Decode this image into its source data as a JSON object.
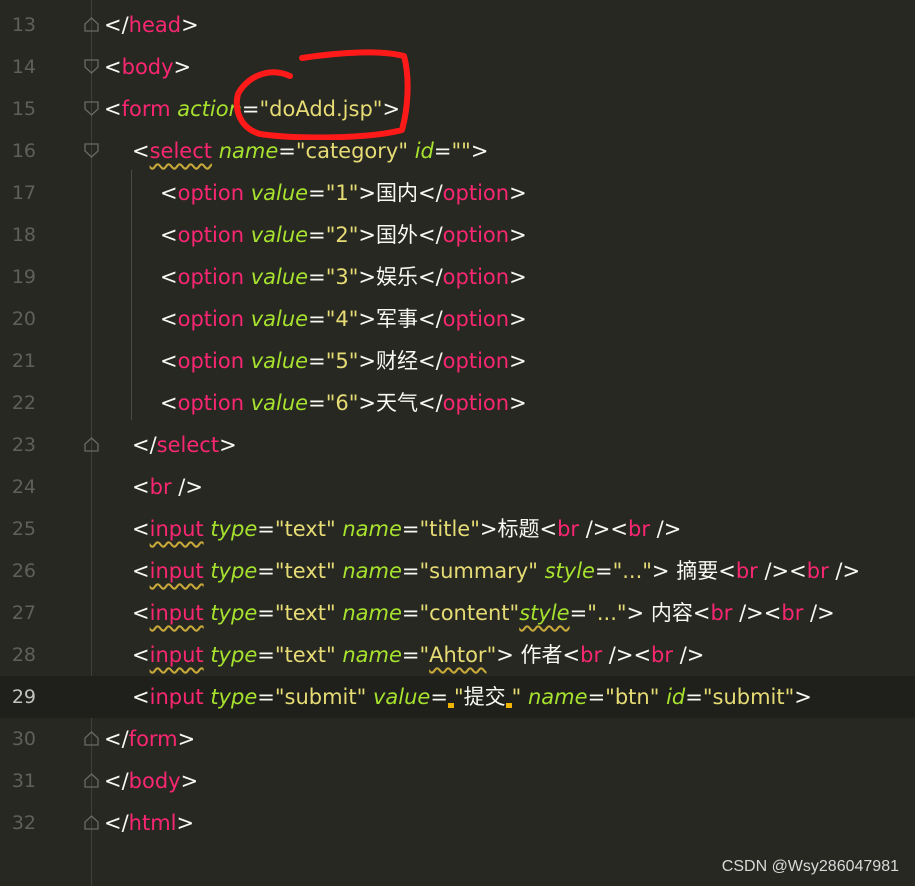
{
  "editor": {
    "lines": [
      {
        "num": "13",
        "parts": [
          [
            "p",
            "</"
          ],
          [
            "t",
            "head"
          ],
          [
            "p",
            ">"
          ]
        ]
      },
      {
        "num": "14",
        "parts": [
          [
            "p",
            "<"
          ],
          [
            "t",
            "body"
          ],
          [
            "p",
            ">"
          ]
        ]
      },
      {
        "num": "15",
        "parts": [
          [
            "p",
            "<"
          ],
          [
            "t",
            "form"
          ],
          [
            "p",
            " "
          ],
          [
            "a",
            "action"
          ],
          [
            "p",
            "="
          ],
          [
            "s",
            "\"doAdd.jsp\""
          ],
          [
            "p",
            ">"
          ]
        ]
      },
      {
        "num": "16",
        "parts": [
          [
            "p",
            "<"
          ],
          [
            "t sq",
            "select"
          ],
          [
            "p",
            " "
          ],
          [
            "a",
            "name"
          ],
          [
            "p",
            "="
          ],
          [
            "s",
            "\"category\""
          ],
          [
            "p",
            " "
          ],
          [
            "a",
            "id"
          ],
          [
            "p",
            "="
          ],
          [
            "s",
            "\"\""
          ],
          [
            "p",
            ">"
          ]
        ]
      },
      {
        "num": "17",
        "parts": [
          [
            "p",
            "<"
          ],
          [
            "t",
            "option"
          ],
          [
            "p",
            " "
          ],
          [
            "a",
            "value"
          ],
          [
            "p",
            "="
          ],
          [
            "s",
            "\"1\""
          ],
          [
            "p",
            ">"
          ],
          [
            "x",
            "国内"
          ],
          [
            "p",
            "</"
          ],
          [
            "t",
            "option"
          ],
          [
            "p",
            ">"
          ]
        ]
      },
      {
        "num": "18",
        "parts": [
          [
            "p",
            "<"
          ],
          [
            "t",
            "option"
          ],
          [
            "p",
            " "
          ],
          [
            "a",
            "value"
          ],
          [
            "p",
            "="
          ],
          [
            "s",
            "\"2\""
          ],
          [
            "p",
            ">"
          ],
          [
            "x",
            "国外"
          ],
          [
            "p",
            "</"
          ],
          [
            "t",
            "option"
          ],
          [
            "p",
            ">"
          ]
        ]
      },
      {
        "num": "19",
        "parts": [
          [
            "p",
            "<"
          ],
          [
            "t",
            "option"
          ],
          [
            "p",
            " "
          ],
          [
            "a",
            "value"
          ],
          [
            "p",
            "="
          ],
          [
            "s",
            "\"3\""
          ],
          [
            "p",
            ">"
          ],
          [
            "x",
            "娱乐"
          ],
          [
            "p",
            "</"
          ],
          [
            "t",
            "option"
          ],
          [
            "p",
            ">"
          ]
        ]
      },
      {
        "num": "20",
        "parts": [
          [
            "p",
            "<"
          ],
          [
            "t",
            "option"
          ],
          [
            "p",
            " "
          ],
          [
            "a",
            "value"
          ],
          [
            "p",
            "="
          ],
          [
            "s",
            "\"4\""
          ],
          [
            "p",
            ">"
          ],
          [
            "x",
            "军事"
          ],
          [
            "p",
            "</"
          ],
          [
            "t",
            "option"
          ],
          [
            "p",
            ">"
          ]
        ]
      },
      {
        "num": "21",
        "parts": [
          [
            "p",
            "<"
          ],
          [
            "t",
            "option"
          ],
          [
            "p",
            " "
          ],
          [
            "a",
            "value"
          ],
          [
            "p",
            "="
          ],
          [
            "s",
            "\"5\""
          ],
          [
            "p",
            ">"
          ],
          [
            "x",
            "财经"
          ],
          [
            "p",
            "</"
          ],
          [
            "t",
            "option"
          ],
          [
            "p",
            ">"
          ]
        ]
      },
      {
        "num": "22",
        "parts": [
          [
            "p",
            "<"
          ],
          [
            "t",
            "option"
          ],
          [
            "p",
            " "
          ],
          [
            "a",
            "value"
          ],
          [
            "p",
            "="
          ],
          [
            "s",
            "\"6\""
          ],
          [
            "p",
            ">"
          ],
          [
            "x",
            "天气"
          ],
          [
            "p",
            "</"
          ],
          [
            "t",
            "option"
          ],
          [
            "p",
            ">"
          ]
        ]
      },
      {
        "num": "23",
        "parts": [
          [
            "p",
            "</"
          ],
          [
            "t",
            "select"
          ],
          [
            "p",
            ">"
          ]
        ]
      },
      {
        "num": "24",
        "parts": [
          [
            "p",
            "<"
          ],
          [
            "t",
            "br"
          ],
          [
            "p",
            " />"
          ]
        ]
      },
      {
        "num": "25",
        "parts": [
          [
            "p",
            "<"
          ],
          [
            "t sq",
            "input"
          ],
          [
            "p",
            " "
          ],
          [
            "a",
            "type"
          ],
          [
            "p",
            "="
          ],
          [
            "s",
            "\"text\""
          ],
          [
            "p",
            " "
          ],
          [
            "a",
            "name"
          ],
          [
            "p",
            "="
          ],
          [
            "s",
            "\"title\""
          ],
          [
            "p",
            ">"
          ],
          [
            "x",
            "标题"
          ],
          [
            "p",
            "<"
          ],
          [
            "t",
            "br"
          ],
          [
            "p",
            " /><"
          ],
          [
            "t",
            "br"
          ],
          [
            "p",
            " />"
          ]
        ]
      },
      {
        "num": "26",
        "parts": [
          [
            "p",
            "<"
          ],
          [
            "t sq",
            "input"
          ],
          [
            "p",
            " "
          ],
          [
            "a",
            "type"
          ],
          [
            "p",
            "="
          ],
          [
            "s",
            "\"text\""
          ],
          [
            "p",
            " "
          ],
          [
            "a",
            "name"
          ],
          [
            "p",
            "="
          ],
          [
            "s",
            "\"summary\""
          ],
          [
            "p",
            " "
          ],
          [
            "a",
            "style"
          ],
          [
            "p",
            "="
          ],
          [
            "s",
            "\"...\""
          ],
          [
            "p",
            "> "
          ],
          [
            "x",
            "摘要"
          ],
          [
            "p",
            "<"
          ],
          [
            "t",
            "br"
          ],
          [
            "p",
            " /><"
          ],
          [
            "t",
            "br"
          ],
          [
            "p",
            " />"
          ]
        ]
      },
      {
        "num": "27",
        "parts": [
          [
            "p",
            "<"
          ],
          [
            "t sq",
            "input"
          ],
          [
            "p",
            " "
          ],
          [
            "a",
            "type"
          ],
          [
            "p",
            "="
          ],
          [
            "s",
            "\"text\""
          ],
          [
            "p",
            " "
          ],
          [
            "a",
            "name"
          ],
          [
            "p",
            "="
          ],
          [
            "s",
            "\"content\""
          ],
          [
            "a sq",
            "style"
          ],
          [
            "p",
            "="
          ],
          [
            "s",
            "\"...\""
          ],
          [
            "p",
            "> "
          ],
          [
            "x",
            "内容"
          ],
          [
            "p",
            "<"
          ],
          [
            "t",
            "br"
          ],
          [
            "p",
            " /><"
          ],
          [
            "t",
            "br"
          ],
          [
            "p",
            " />"
          ]
        ]
      },
      {
        "num": "28",
        "parts": [
          [
            "p",
            "<"
          ],
          [
            "t sq",
            "input"
          ],
          [
            "p",
            " "
          ],
          [
            "a",
            "type"
          ],
          [
            "p",
            "="
          ],
          [
            "s",
            "\"text\""
          ],
          [
            "p",
            " "
          ],
          [
            "a",
            "name"
          ],
          [
            "p",
            "="
          ],
          [
            "s",
            "\""
          ],
          [
            "s sq",
            "Ahtor"
          ],
          [
            "s",
            "\""
          ],
          [
            "p",
            "> "
          ],
          [
            "x",
            "作者"
          ],
          [
            "p",
            "<"
          ],
          [
            "t",
            "br"
          ],
          [
            "p",
            " /><"
          ],
          [
            "t",
            "br"
          ],
          [
            "p",
            " />"
          ]
        ]
      },
      {
        "num": "29",
        "parts": [
          [
            "p",
            "<"
          ],
          [
            "t",
            "input"
          ],
          [
            "p",
            " "
          ],
          [
            "a",
            "type"
          ],
          [
            "p",
            "="
          ],
          [
            "s",
            "\"submit\""
          ],
          [
            "p",
            " "
          ],
          [
            "a",
            "value"
          ],
          [
            "p",
            "="
          ],
          [
            "cur",
            ""
          ],
          [
            "s",
            "\""
          ],
          [
            "x",
            "提交"
          ],
          [
            "cur",
            ""
          ],
          [
            "s",
            "\""
          ],
          [
            "p",
            " "
          ],
          [
            "a",
            "name"
          ],
          [
            "p",
            "="
          ],
          [
            "s",
            "\"btn\""
          ],
          [
            "p",
            " "
          ],
          [
            "a",
            "id"
          ],
          [
            "p",
            "="
          ],
          [
            "s",
            "\"submit\""
          ],
          [
            "p",
            ">"
          ]
        ]
      },
      {
        "num": "30",
        "parts": [
          [
            "p",
            "</"
          ],
          [
            "t",
            "form"
          ],
          [
            "p",
            ">"
          ]
        ]
      },
      {
        "num": "31",
        "parts": [
          [
            "p",
            "</"
          ],
          [
            "t",
            "body"
          ],
          [
            "p",
            ">"
          ]
        ]
      },
      {
        "num": "32",
        "parts": [
          [
            "p",
            "</"
          ],
          [
            "t",
            "html"
          ],
          [
            "p",
            ">"
          ]
        ]
      }
    ]
  },
  "watermark": "CSDN @Wsy286047981",
  "colors": {
    "background": "#272822",
    "tag": "#f92672",
    "attr": "#a6e22e",
    "string": "#e6db74",
    "annotation": "#ff1a1a"
  }
}
